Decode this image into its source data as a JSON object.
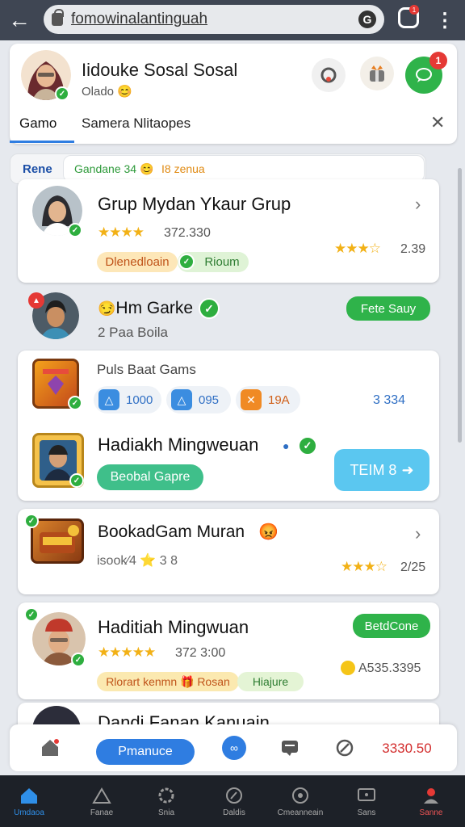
{
  "browser": {
    "url": "fomowinalantinguah",
    "tabs_count": "1"
  },
  "profile": {
    "name": "Iidouke Sosal Sosal",
    "subtitle": "Olado 😊",
    "tab_active": "Gamo",
    "tab_other": "Samera Nlitaopes",
    "notif_count": "1"
  },
  "chips": {
    "rene": "Rene",
    "green": "Gandane 34 😊",
    "orange": "I8 zenua"
  },
  "items": [
    {
      "title": "Grup Mydan Ykaur Grup",
      "rating_value": "372.330",
      "right_value": "2.39",
      "tag_label": "Dlenedloain",
      "tag2_label": "Rioum"
    },
    {
      "title": "Hm Garke",
      "subtitle": "2 Paa Boila",
      "button": "Fete Sauy"
    },
    {
      "header": "Puls Baat Gams",
      "stats": [
        "1000",
        "095",
        "19A",
        "3 334"
      ]
    },
    {
      "title": "Hadiakh Mingweuan",
      "tag_label": "Beobal Gapre",
      "button": "TEIM 8"
    },
    {
      "title": "BookadGam Muran",
      "sub_value": "isook∕4 ⭐ 3 8",
      "right_value": "2/25"
    },
    {
      "title": "Haditiah Mingwuan",
      "rating_value": "372 3:00",
      "button": "BetdCone",
      "tag_label": "Rlorart kenmn 🎁 Rosan",
      "tag2_label": "Hiajure",
      "right_value": "A535.3395"
    },
    {
      "title": "Dandi Fanan Kanuain"
    }
  ],
  "actionbar": {
    "primary_button": "Pmanuce",
    "amount": "3330.50"
  },
  "nav": [
    {
      "label": "Umdaoa",
      "icon": "home-icon"
    },
    {
      "label": "Fanae",
      "icon": "tent-icon"
    },
    {
      "label": "Snia",
      "icon": "gear-icon"
    },
    {
      "label": "Daldis",
      "icon": "compass-icon"
    },
    {
      "label": "Cmeanneain",
      "icon": "target-icon"
    },
    {
      "label": "Sans",
      "icon": "screen-icon"
    },
    {
      "label": "Sanne",
      "icon": "profile-icon"
    }
  ],
  "colors": {
    "accent_blue": "#2f7de1",
    "accent_green": "#2fb34a",
    "star_gold": "#f2b116",
    "nav_bg": "#1d2128",
    "badge_red": "#e53935"
  }
}
